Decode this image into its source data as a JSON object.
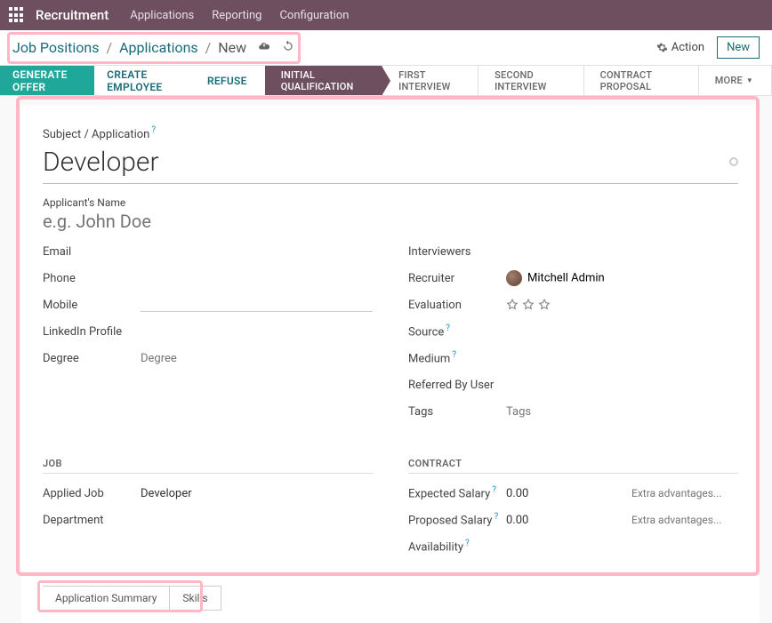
{
  "topnav": {
    "brand": "Recruitment",
    "items": [
      "Applications",
      "Reporting",
      "Configuration"
    ]
  },
  "breadcrumb": {
    "items": [
      "Job Positions",
      "Applications",
      "New"
    ]
  },
  "actions": {
    "action_label": "Action",
    "new_label": "New"
  },
  "buttons": {
    "generate_offer": "GENERATE OFFER",
    "create_employee": "CREATE EMPLOYEE",
    "refuse": "REFUSE"
  },
  "stages": {
    "items": [
      "INITIAL QUALIFICATION",
      "FIRST INTERVIEW",
      "SECOND INTERVIEW",
      "CONTRACT PROPOSAL"
    ],
    "active_index": 0,
    "more": "MORE"
  },
  "form": {
    "subject_label": "Subject / Application",
    "subject_value": "Developer",
    "applicant_label": "Applicant's Name",
    "applicant_placeholder": "e.g. John Doe",
    "left_fields": {
      "email": "Email",
      "phone": "Phone",
      "mobile": "Mobile",
      "linkedin": "LinkedIn Profile",
      "degree": "Degree",
      "degree_placeholder": "Degree"
    },
    "right_fields": {
      "interviewers": "Interviewers",
      "recruiter": "Recruiter",
      "recruiter_value": "Mitchell Admin",
      "evaluation": "Evaluation",
      "source": "Source",
      "medium": "Medium",
      "referred": "Referred By User",
      "tags": "Tags",
      "tags_placeholder": "Tags"
    },
    "job_section": {
      "header": "JOB",
      "applied_job": "Applied Job",
      "applied_job_value": "Developer",
      "department": "Department"
    },
    "contract_section": {
      "header": "CONTRACT",
      "expected_salary": "Expected Salary",
      "expected_salary_value": "0.00",
      "proposed_salary": "Proposed Salary",
      "proposed_salary_value": "0.00",
      "extra_placeholder": "Extra advantages...",
      "availability": "Availability"
    },
    "tabs": [
      "Application Summary",
      "Skills"
    ]
  }
}
